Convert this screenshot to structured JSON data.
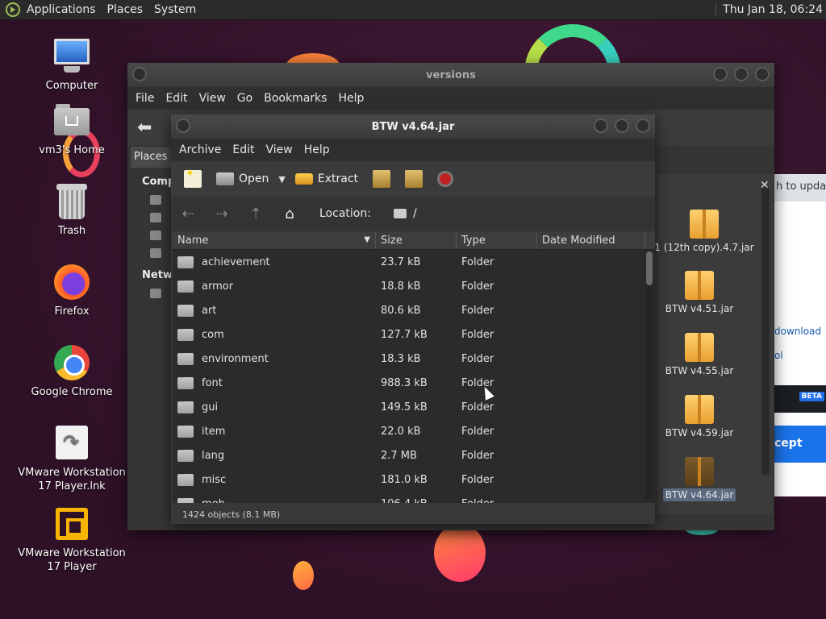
{
  "top_panel": {
    "menus": [
      "Applications",
      "Places",
      "System"
    ],
    "clock": "Thu Jan 18, 06:24"
  },
  "desktop_icons": [
    {
      "label": "Computer",
      "icon": "computer-icon"
    },
    {
      "label": "vm3's Home",
      "icon": "home-folder-icon"
    },
    {
      "label": "Trash",
      "icon": "trash-icon"
    },
    {
      "label": "Firefox",
      "icon": "firefox-icon"
    },
    {
      "label": "Google Chrome",
      "icon": "chrome-icon"
    },
    {
      "label": "VMware Workstation 17 Player.lnk",
      "icon": "shortcut-file-icon"
    },
    {
      "label": "VMware Workstation 17 Player",
      "icon": "vmware-icon"
    }
  ],
  "versions_window": {
    "title": "versions",
    "menus": [
      "File",
      "Edit",
      "View",
      "Go",
      "Bookmarks",
      "Help"
    ],
    "places_label": "Places",
    "sidebar_sections": [
      "Comp",
      "Netw"
    ],
    "files": [
      {
        "name": "1 (12th copy).4.7.jar",
        "selected": false
      },
      {
        "name": "BTW v4.51.jar",
        "selected": false
      },
      {
        "name": "BTW v4.55.jar",
        "selected": false
      },
      {
        "name": "BTW v4.59.jar",
        "selected": false
      },
      {
        "name": "BTW v4.64.jar",
        "selected": true
      }
    ]
  },
  "browser_peek": {
    "tab_text": "h to update",
    "link1": "download",
    "link2": "ol",
    "beta": "BETA",
    "accept": "cept"
  },
  "archive_window": {
    "title": "BTW v4.64.jar",
    "menus": [
      "Archive",
      "Edit",
      "View",
      "Help"
    ],
    "toolbar": {
      "open_label": "Open",
      "extract_label": "Extract"
    },
    "location_label": "Location:",
    "location_path": "/",
    "columns": [
      "Name",
      "Size",
      "Type",
      "Date Modified"
    ],
    "rows": [
      {
        "name": "achievement",
        "size": "23.7 kB",
        "type": "Folder",
        "date": ""
      },
      {
        "name": "armor",
        "size": "18.8 kB",
        "type": "Folder",
        "date": ""
      },
      {
        "name": "art",
        "size": "80.6 kB",
        "type": "Folder",
        "date": ""
      },
      {
        "name": "com",
        "size": "127.7 kB",
        "type": "Folder",
        "date": ""
      },
      {
        "name": "environment",
        "size": "18.3 kB",
        "type": "Folder",
        "date": ""
      },
      {
        "name": "font",
        "size": "988.3 kB",
        "type": "Folder",
        "date": ""
      },
      {
        "name": "gui",
        "size": "149.5 kB",
        "type": "Folder",
        "date": ""
      },
      {
        "name": "item",
        "size": "22.0 kB",
        "type": "Folder",
        "date": ""
      },
      {
        "name": "lang",
        "size": "2.7 MB",
        "type": "Folder",
        "date": ""
      },
      {
        "name": "misc",
        "size": "181.0 kB",
        "type": "Folder",
        "date": ""
      },
      {
        "name": "mob",
        "size": "106.4 kB",
        "type": "Folder",
        "date": ""
      }
    ],
    "status": "1424 objects (8.1 MB)"
  }
}
